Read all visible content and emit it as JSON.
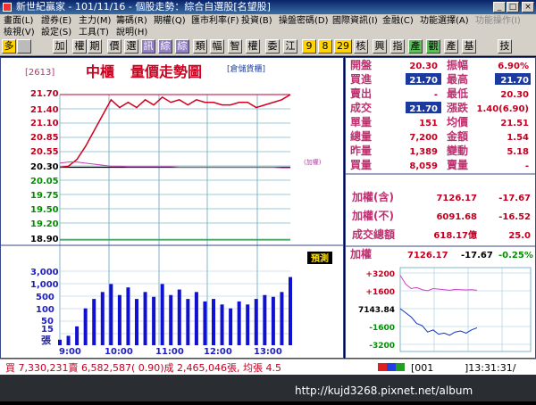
{
  "window": {
    "title": "新世紀贏家 - 101/11/16 - 個股走勢：綜合自選股[名望股]",
    "btn_min": "_",
    "btn_max": "□",
    "btn_close": "×"
  },
  "menu": {
    "row1": [
      "畫面(L)",
      "證券(E)",
      "主力(M)",
      "籌碼(R)",
      "期權(Q)",
      "匯市利率(F)",
      "投資(B)",
      "操盤密碼(D)",
      "國際資訊(I)",
      "金融(C)",
      "功能選擇(A)",
      "功能操作(I)"
    ],
    "row2": [
      "檢視(V)",
      "設定(S)",
      "工具(T)",
      "說明(H)"
    ]
  },
  "toolbar": {
    "buttons": [
      "多",
      "加",
      "權",
      "期",
      "價",
      "選",
      "訊",
      "綜",
      "綜",
      "類",
      "幅",
      "智",
      "權",
      "委",
      "江",
      "9",
      "8",
      "29",
      "核",
      "興",
      "指",
      "產",
      "觀",
      "產",
      "基",
      "技"
    ]
  },
  "chart": {
    "stock_code": "[2613]",
    "title_left": "中櫃",
    "title_right": "量價走勢圖",
    "subtitle": "[倉儲貨櫃]",
    "index_label": "(加權)",
    "predict_label": "預測",
    "y_price_labels": [
      "21.70",
      "21.40",
      "21.10",
      "20.85",
      "20.55",
      "20.30",
      "20.05",
      "19.75",
      "19.50",
      "19.20",
      "18.90"
    ],
    "y_volume_labels": [
      "3,000",
      "1,000",
      "500",
      "100",
      "50",
      "15"
    ],
    "volume_unit": "張",
    "x_labels": [
      "9:00",
      "10:00",
      "11:00",
      "12:00",
      "13:00"
    ]
  },
  "chart_data": {
    "type": "line",
    "title": "量價走勢圖",
    "x": [
      "9:00",
      "9:20",
      "9:40",
      "9:45",
      "9:50",
      "9:55",
      "10:00",
      "10:10",
      "10:20",
      "10:30",
      "10:40",
      "10:50",
      "11:00",
      "11:10",
      "11:20",
      "11:30",
      "11:40",
      "11:50",
      "12:00",
      "12:10",
      "12:20",
      "12:30",
      "12:40",
      "12:50",
      "13:00",
      "13:10",
      "13:20",
      "13:30"
    ],
    "series": [
      {
        "name": "成交價",
        "values": [
          20.3,
          20.32,
          20.45,
          20.7,
          21.0,
          21.3,
          21.6,
          21.45,
          21.55,
          21.45,
          21.6,
          21.5,
          21.65,
          21.55,
          21.6,
          21.5,
          21.6,
          21.55,
          21.55,
          21.5,
          21.5,
          21.55,
          21.55,
          21.45,
          21.5,
          21.55,
          21.6,
          21.7
        ]
      },
      {
        "name": "加權",
        "values": [
          20.38,
          20.4,
          20.4,
          20.38,
          20.36,
          20.34,
          20.32,
          20.32,
          20.31,
          20.31,
          20.31,
          20.31,
          20.31,
          20.31,
          20.3,
          20.3,
          20.3,
          20.3,
          20.3,
          20.3,
          20.3,
          20.3,
          20.3,
          20.3,
          20.3,
          20.3,
          20.29,
          20.29
        ]
      }
    ],
    "volume": [
      15,
      20,
      40,
      150,
      300,
      500,
      900,
      400,
      700,
      300,
      500,
      350,
      900,
      400,
      600,
      300,
      500,
      250,
      300,
      200,
      150,
      250,
      200,
      300,
      400,
      350,
      500,
      1500
    ],
    "ylim": [
      18.9,
      21.7
    ],
    "reference_price": 20.3
  },
  "quote": {
    "rows": [
      [
        "開盤",
        "20.30",
        "振幅",
        "6.90%"
      ],
      [
        "買進",
        "21.70",
        "最高",
        "21.70"
      ],
      [
        "賣出",
        "-",
        "最低",
        "20.30"
      ],
      [
        "成交",
        "21.70",
        "漲跌",
        "1.40(6.90)"
      ],
      [
        "單量",
        "151",
        "均價",
        "21.51"
      ],
      [
        "總量",
        "7,200",
        "金額",
        "1.54"
      ],
      [
        "昨量",
        "1,389",
        "變動",
        "5.18"
      ],
      [
        "買量",
        "8,059",
        "賣量",
        "-"
      ]
    ]
  },
  "index": {
    "rows": [
      [
        "加權(含)",
        "7126.17",
        "-17.67"
      ],
      [
        "加權(不)",
        "6091.68",
        "-16.52"
      ],
      [
        "成交總額",
        "618.17億",
        "25.0"
      ]
    ]
  },
  "mini": {
    "label": "加權",
    "value": "7126.17",
    "change": "-17.67",
    "pct": "-0.25%",
    "y_labels": [
      "+3200",
      "+1600",
      "7143.84",
      "-1600",
      "-3200"
    ],
    "chart_data": {
      "type": "line",
      "series": [
        {
          "name": "加權",
          "values": [
            7143.84,
            7140,
            7136,
            7130,
            7128,
            7122,
            7124,
            7120,
            7121,
            7119,
            7122,
            7123,
            7121,
            7124,
            7126
          ]
        },
        {
          "name": "漲跌家數差",
          "values": [
            3000,
            2200,
            1800,
            1900,
            1700,
            1600,
            1800,
            1750,
            1700,
            1650,
            1720,
            1700,
            1680,
            1700,
            1650
          ]
        }
      ]
    }
  },
  "status": {
    "text": "買 7,330,231賣 6,582,587( 0.90)成 2,465,046張, 均張 4.5",
    "code": "[001",
    "time": "]13:31:31/"
  },
  "taskbar": {
    "watermark": "http://kujd3268.pixnet.net/album"
  }
}
